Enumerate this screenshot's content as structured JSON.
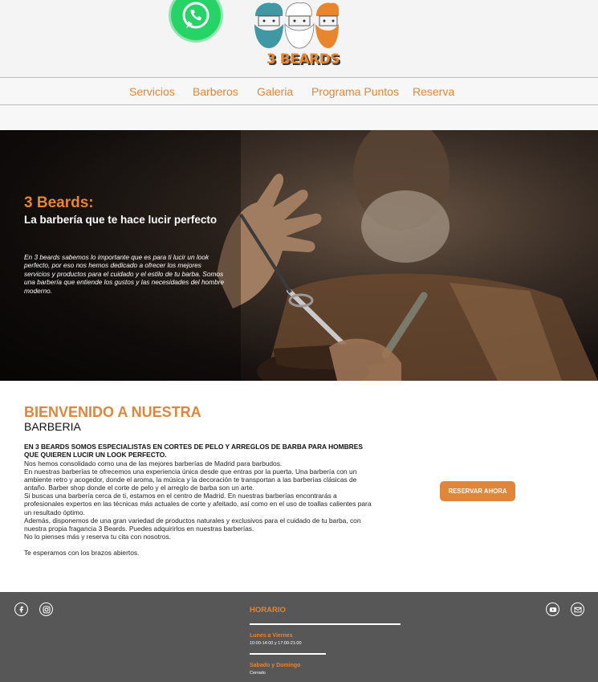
{
  "header": {
    "brand": "3 BEARDS",
    "icons": [
      "whatsapp-icon",
      "three-beards-logo"
    ]
  },
  "nav": {
    "items": [
      {
        "label": "Servicios"
      },
      {
        "label": "Barberos"
      },
      {
        "label": "Galeria"
      },
      {
        "label": "Programa Puntos"
      },
      {
        "label": "Reserva"
      }
    ]
  },
  "hero": {
    "title": "3 Beards:",
    "subtitle": "La barbería que te hace lucir perfecto",
    "text": "En 3 beards sabemos lo importante que es para ti lucir un look perfecto, por eso nos hemos dedicado a ofrecer los mejores servicios y productos para el cuidado y el estilo de tu barba. Somos una barbería que entiende los gustos y las necesidades del hombre moderno."
  },
  "welcome": {
    "heading": "BIENVENIDO A NUESTRA",
    "subheading": "BARBERIA",
    "intro": "EN 3 BEARDS SOMOS ESPECIALISTAS EN CORTES DE PELO Y ARREGLOS DE BARBA PARA HOMBRES QUE QUIEREN LUCIR UN LOOK PERFECTO.",
    "paragraphs": [
      "Nos hemos consolidado como una de las mejores barberías de Madrid para barbudos.",
      "En nuestras barberías te ofrecemos una experiencia única desde que entras por la puerta. Una barbería con un ambiente retro y acogedor, donde el aroma, la música y la decoración te transportan a las barberías clásicas de antaño. Barber shop donde el corte de pelo y el arreglo de barba son un arte.",
      "Si buscas una barbería cerca de ti, estamos en el centro de Madrid. En nuestras barberías encontrarás a profesionales expertos en las técnicas más actuales de corte y afeitado, así como en el uso de toallas calientes para un resultado óptimo.",
      "Además, disponemos de una gran variedad de productos naturales y exclusivos para el cuidado de tu barba, con nuestra propia fragancia 3 Beards. Puedes adquirirlos en nuestras barberías.",
      "No lo pienses más y reserva tu cita con nosotros."
    ],
    "closing": "Te esperamos con los brazos abiertos.",
    "cta": "RESERVAR AHORA"
  },
  "footer": {
    "social_left": [
      "facebook-icon",
      "instagram-icon"
    ],
    "social_right": [
      "youtube-icon",
      "mail-icon"
    ],
    "horario_title": "HORARIO",
    "weekdays_label": "Lunes a Viernes",
    "weekdays_hours": "10:00-14:00 y 17:00-21:00",
    "weekend_label": "Sabado y Domingo",
    "weekend_hours": "Cerrado"
  },
  "colors": {
    "accent": "#e0863a",
    "footer_bg": "#575757",
    "whatsapp": "#25d366"
  }
}
